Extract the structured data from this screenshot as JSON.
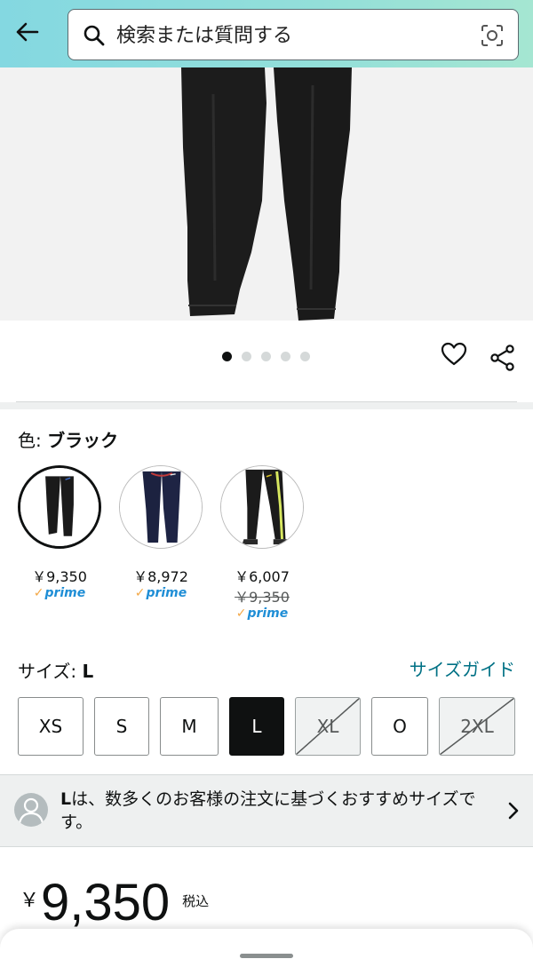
{
  "header": {
    "search_placeholder": "検索または質問する",
    "back_icon": "back-arrow-icon",
    "search_icon": "search-icon",
    "camera_icon": "camera-lens-icon",
    "gradient_colors": [
      "#84d8e1",
      "#a5e6d2"
    ]
  },
  "carousel": {
    "total_images": 5,
    "active_index": 0
  },
  "actions": {
    "favorite_icon": "heart-icon",
    "share_icon": "share-icon"
  },
  "color": {
    "label": "色:",
    "selected": "ブラック",
    "options": [
      {
        "price": "￥9,350",
        "prime": "prime",
        "selected": true
      },
      {
        "price": "￥8,972",
        "prime": "prime",
        "selected": false
      },
      {
        "price": "￥6,007",
        "list_price": "￥9,350",
        "prime": "prime",
        "selected": false
      }
    ]
  },
  "size": {
    "label": "サイズ:",
    "selected": "L",
    "guide_link": "サイズガイド",
    "options": [
      {
        "label": "XS",
        "state": "available"
      },
      {
        "label": "S",
        "state": "available"
      },
      {
        "label": "M",
        "state": "available"
      },
      {
        "label": "L",
        "state": "selected"
      },
      {
        "label": "XL",
        "state": "unavailable"
      },
      {
        "label": "O",
        "state": "available"
      },
      {
        "label": "2XL",
        "state": "unavailable"
      }
    ]
  },
  "recommendation": {
    "size": "L",
    "text": "は、数多くのお客様の注文に基づくおすすめサイズです。"
  },
  "price": {
    "currency": "￥",
    "amount": "9,350",
    "tax_note": "税込"
  },
  "colors": {
    "accent_link": "#007185",
    "prime_blue": "#1f8ed6",
    "prime_check": "#f3a847",
    "text": "#0f1111"
  }
}
